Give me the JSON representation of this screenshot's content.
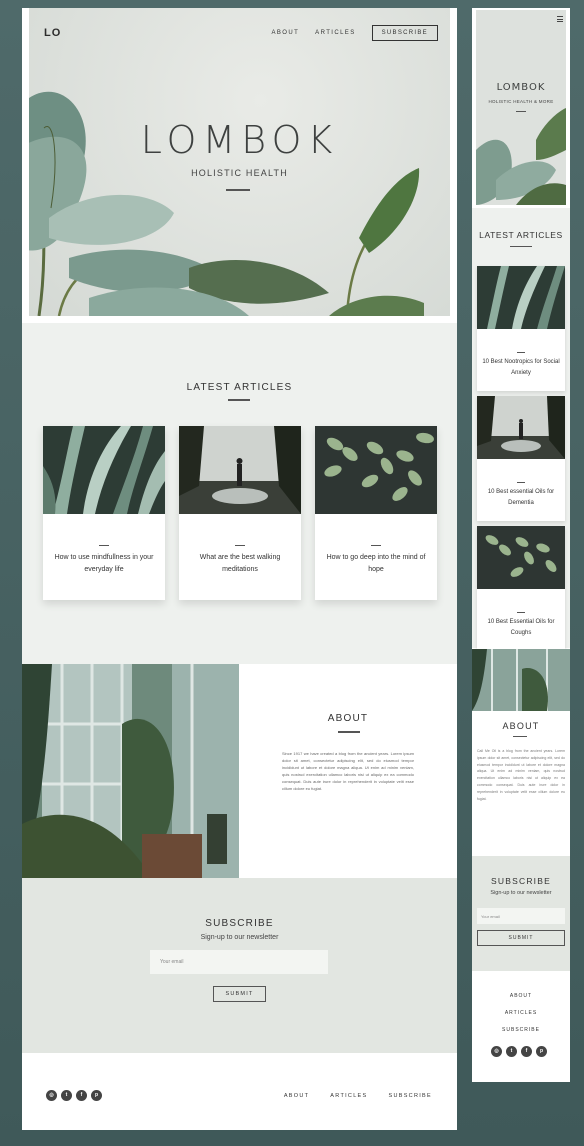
{
  "desktop": {
    "logo": "LO",
    "nav": {
      "about": "ABOUT",
      "articles": "ARTICLES",
      "subscribe": "SUBSCRIBE"
    },
    "hero": {
      "title": "LOMBOK",
      "subtitle": "HOLISTIC HEALTH"
    },
    "latest": {
      "title": "LATEST ARTICLES",
      "cards": [
        {
          "text": "How to use mindfullness in your everyday life",
          "image": "leaves-closeup"
        },
        {
          "text": "What are the best walking meditations",
          "image": "forest-walk"
        },
        {
          "text": "How to go deep into the mind of hope",
          "image": "fern-leaves"
        }
      ]
    },
    "about": {
      "title": "ABOUT",
      "body": "Since 1917 we have created a blog from the ancient years. Lorem ipsum dolor sit amet, consectetur adipiscing elit, sed do eiusmod tempor incididunt ut labore et dolore magna aliqua. Ut enim ad minim veniam, quis nostrud exercitation ullamco laboris nisi ut aliquip ex ea commodo consequat. Duis aute irure dolor in reprehenderit in voluptate velit esse cillum dolore eu fugiat."
    },
    "subscribe": {
      "title": "SUBSCRIBE",
      "tagline": "Sign-up to our newsletter",
      "email_placeholder": "Your email",
      "submit": "SUBMIT"
    },
    "footer": {
      "nav": {
        "about": "ABOUT",
        "articles": "ARTICLES",
        "subscribe": "SUBSCRIBE"
      },
      "socials": [
        "instagram-icon",
        "twitter-icon",
        "facebook-icon",
        "pinterest-icon"
      ]
    }
  },
  "mobile": {
    "hero": {
      "title": "LOMBOK",
      "subtitle": "HOLISTIC HEALTH & MORE"
    },
    "latest": {
      "title": "LATEST ARTICLES",
      "cards": [
        {
          "text": "10 Best Nootropics for Social Anxiety"
        },
        {
          "text": "10 Best essential Oils for Dementia"
        },
        {
          "text": "10 Best Essential Oils for Coughs"
        }
      ]
    },
    "about": {
      "title": "ABOUT",
      "body": "Call Me Oil is a blog from the ancient years. Lorem ipsum dolor sit amet, consectetur adipiscing elit, sed do eiusmod tempor incididunt ut labore et dolore magna aliqua. Ut enim ad minim veniam, quis nostrud exercitation ullamco laboris nisi ut aliquip ex ea commodo consequat. Duis aute irure dolor in reprehenderit in voluptate velit esse cillum dolore eu fugiat."
    },
    "subscribe": {
      "title": "SUBSCRIBE",
      "tagline": "Sign-up to our newsletter",
      "email_placeholder": "Your email",
      "submit": "SUBMIT"
    },
    "footer": {
      "about": "ABOUT",
      "articles": "ARTICLES",
      "subscribe": "SUBSCRIBE"
    }
  }
}
